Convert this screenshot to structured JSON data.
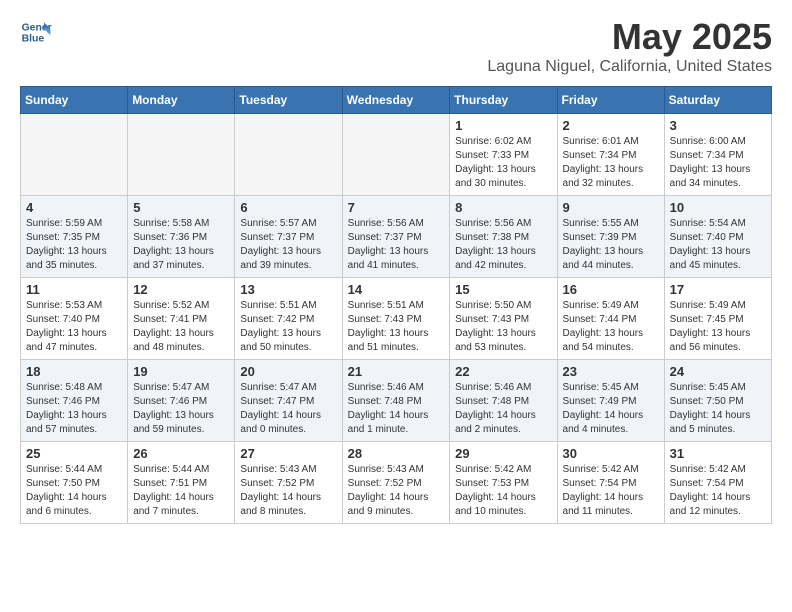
{
  "header": {
    "logo_line1": "General",
    "logo_line2": "Blue",
    "month": "May 2025",
    "location": "Laguna Niguel, California, United States"
  },
  "weekdays": [
    "Sunday",
    "Monday",
    "Tuesday",
    "Wednesday",
    "Thursday",
    "Friday",
    "Saturday"
  ],
  "weeks": [
    [
      {
        "day": "",
        "info": ""
      },
      {
        "day": "",
        "info": ""
      },
      {
        "day": "",
        "info": ""
      },
      {
        "day": "",
        "info": ""
      },
      {
        "day": "1",
        "info": "Sunrise: 6:02 AM\nSunset: 7:33 PM\nDaylight: 13 hours\nand 30 minutes."
      },
      {
        "day": "2",
        "info": "Sunrise: 6:01 AM\nSunset: 7:34 PM\nDaylight: 13 hours\nand 32 minutes."
      },
      {
        "day": "3",
        "info": "Sunrise: 6:00 AM\nSunset: 7:34 PM\nDaylight: 13 hours\nand 34 minutes."
      }
    ],
    [
      {
        "day": "4",
        "info": "Sunrise: 5:59 AM\nSunset: 7:35 PM\nDaylight: 13 hours\nand 35 minutes."
      },
      {
        "day": "5",
        "info": "Sunrise: 5:58 AM\nSunset: 7:36 PM\nDaylight: 13 hours\nand 37 minutes."
      },
      {
        "day": "6",
        "info": "Sunrise: 5:57 AM\nSunset: 7:37 PM\nDaylight: 13 hours\nand 39 minutes."
      },
      {
        "day": "7",
        "info": "Sunrise: 5:56 AM\nSunset: 7:37 PM\nDaylight: 13 hours\nand 41 minutes."
      },
      {
        "day": "8",
        "info": "Sunrise: 5:56 AM\nSunset: 7:38 PM\nDaylight: 13 hours\nand 42 minutes."
      },
      {
        "day": "9",
        "info": "Sunrise: 5:55 AM\nSunset: 7:39 PM\nDaylight: 13 hours\nand 44 minutes."
      },
      {
        "day": "10",
        "info": "Sunrise: 5:54 AM\nSunset: 7:40 PM\nDaylight: 13 hours\nand 45 minutes."
      }
    ],
    [
      {
        "day": "11",
        "info": "Sunrise: 5:53 AM\nSunset: 7:40 PM\nDaylight: 13 hours\nand 47 minutes."
      },
      {
        "day": "12",
        "info": "Sunrise: 5:52 AM\nSunset: 7:41 PM\nDaylight: 13 hours\nand 48 minutes."
      },
      {
        "day": "13",
        "info": "Sunrise: 5:51 AM\nSunset: 7:42 PM\nDaylight: 13 hours\nand 50 minutes."
      },
      {
        "day": "14",
        "info": "Sunrise: 5:51 AM\nSunset: 7:43 PM\nDaylight: 13 hours\nand 51 minutes."
      },
      {
        "day": "15",
        "info": "Sunrise: 5:50 AM\nSunset: 7:43 PM\nDaylight: 13 hours\nand 53 minutes."
      },
      {
        "day": "16",
        "info": "Sunrise: 5:49 AM\nSunset: 7:44 PM\nDaylight: 13 hours\nand 54 minutes."
      },
      {
        "day": "17",
        "info": "Sunrise: 5:49 AM\nSunset: 7:45 PM\nDaylight: 13 hours\nand 56 minutes."
      }
    ],
    [
      {
        "day": "18",
        "info": "Sunrise: 5:48 AM\nSunset: 7:46 PM\nDaylight: 13 hours\nand 57 minutes."
      },
      {
        "day": "19",
        "info": "Sunrise: 5:47 AM\nSunset: 7:46 PM\nDaylight: 13 hours\nand 59 minutes."
      },
      {
        "day": "20",
        "info": "Sunrise: 5:47 AM\nSunset: 7:47 PM\nDaylight: 14 hours\nand 0 minutes."
      },
      {
        "day": "21",
        "info": "Sunrise: 5:46 AM\nSunset: 7:48 PM\nDaylight: 14 hours\nand 1 minute."
      },
      {
        "day": "22",
        "info": "Sunrise: 5:46 AM\nSunset: 7:48 PM\nDaylight: 14 hours\nand 2 minutes."
      },
      {
        "day": "23",
        "info": "Sunrise: 5:45 AM\nSunset: 7:49 PM\nDaylight: 14 hours\nand 4 minutes."
      },
      {
        "day": "24",
        "info": "Sunrise: 5:45 AM\nSunset: 7:50 PM\nDaylight: 14 hours\nand 5 minutes."
      }
    ],
    [
      {
        "day": "25",
        "info": "Sunrise: 5:44 AM\nSunset: 7:50 PM\nDaylight: 14 hours\nand 6 minutes."
      },
      {
        "day": "26",
        "info": "Sunrise: 5:44 AM\nSunset: 7:51 PM\nDaylight: 14 hours\nand 7 minutes."
      },
      {
        "day": "27",
        "info": "Sunrise: 5:43 AM\nSunset: 7:52 PM\nDaylight: 14 hours\nand 8 minutes."
      },
      {
        "day": "28",
        "info": "Sunrise: 5:43 AM\nSunset: 7:52 PM\nDaylight: 14 hours\nand 9 minutes."
      },
      {
        "day": "29",
        "info": "Sunrise: 5:42 AM\nSunset: 7:53 PM\nDaylight: 14 hours\nand 10 minutes."
      },
      {
        "day": "30",
        "info": "Sunrise: 5:42 AM\nSunset: 7:54 PM\nDaylight: 14 hours\nand 11 minutes."
      },
      {
        "day": "31",
        "info": "Sunrise: 5:42 AM\nSunset: 7:54 PM\nDaylight: 14 hours\nand 12 minutes."
      }
    ]
  ]
}
